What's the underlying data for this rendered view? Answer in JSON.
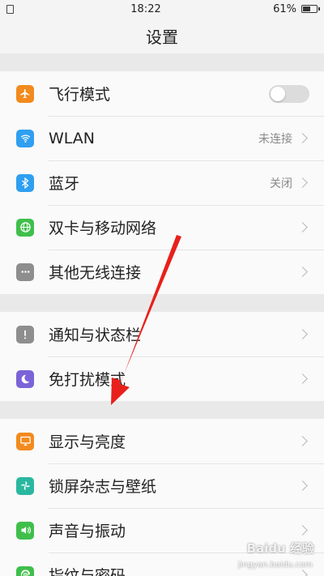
{
  "status_bar": {
    "time": "18:22",
    "battery_text": "61%",
    "battery_level": 0.61
  },
  "header": {
    "title": "设置"
  },
  "sections": [
    {
      "items": [
        {
          "label": "飞行模式",
          "icon": "airplane-icon",
          "icon_color": "#f28a1d",
          "control": "toggle",
          "toggle_on": false
        },
        {
          "label": "WLAN",
          "icon": "wifi-icon",
          "icon_color": "#2f9ff0",
          "value": "未连接"
        },
        {
          "label": "蓝牙",
          "icon": "bluetooth-icon",
          "icon_color": "#2f9ff0",
          "value": "关闭"
        },
        {
          "label": "双卡与移动网络",
          "icon": "globe-icon",
          "icon_color": "#3fbf4a"
        },
        {
          "label": "其他无线连接",
          "icon": "more-dots-icon",
          "icon_color": "#8e8e8e"
        }
      ]
    },
    {
      "items": [
        {
          "label": "通知与状态栏",
          "icon": "notification-icon",
          "icon_color": "#8e8e8e"
        },
        {
          "label": "免打扰模式",
          "icon": "moon-icon",
          "icon_color": "#7b63d8"
        }
      ]
    },
    {
      "items": [
        {
          "label": "显示与亮度",
          "icon": "display-icon",
          "icon_color": "#f28a1d"
        },
        {
          "label": "锁屏杂志与壁纸",
          "icon": "pinwheel-icon",
          "icon_color": "#2ab7a0"
        },
        {
          "label": "声音与振动",
          "icon": "speaker-icon",
          "icon_color": "#3fbf4a"
        },
        {
          "label": "指纹与密码",
          "icon": "fingerprint-icon",
          "icon_color": "#3fbf4a"
        }
      ]
    }
  ],
  "annotation": {
    "arrow_color": "#e8201c"
  },
  "watermark": {
    "brand": "Baidu 经验",
    "url": "jingyan.baidu.com"
  }
}
